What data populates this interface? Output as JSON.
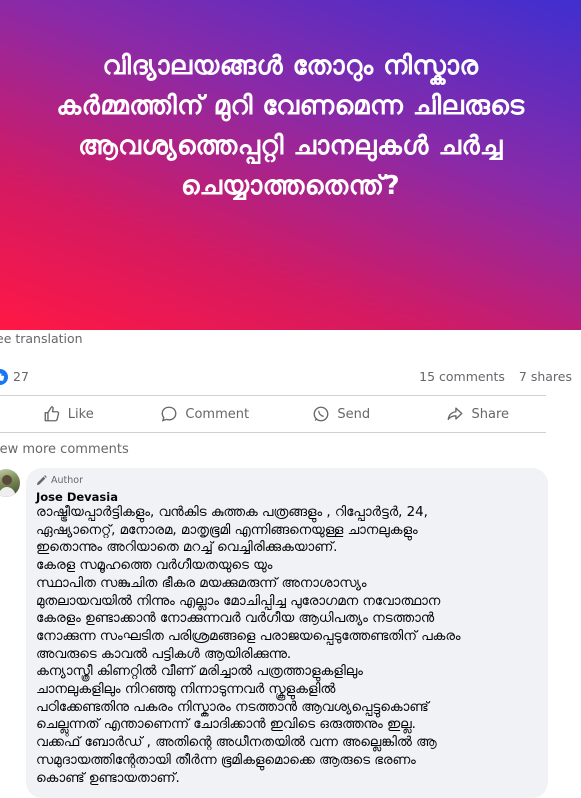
{
  "banner": {
    "title": "വിദ്യാലയങ്ങൾ തോറും നിസ്കാര കർമ്മത്തിന് മുറി വേണമെന്ന ചിലരുടെ ആവശ്യത്തെപ്പറ്റി ചാനലുകൾ ചർച്ച ചെയ്യാത്തതെന്ത്?"
  },
  "post": {
    "see_translation": "ee translation",
    "reaction_count": "27",
    "comments_count": "15 comments",
    "shares_count": "7 shares"
  },
  "actions": {
    "like": "Like",
    "comment": "Comment",
    "send": "Send",
    "share": "Share"
  },
  "comments_section": {
    "view_more": "iew more comments"
  },
  "comment": {
    "badge": "Author",
    "author": "Jose Devasia",
    "lines": [
      "രാഷ്ട്രീയപ്പാർട്ടികളും, വൻകിട കുത്തക പത്രങ്ങളും , റിപ്പോർട്ടർ, 24,",
      "ഏഷ്യാനെറ്റ്, മനോരമ, മാതൃഭൂമി എന്നിങ്ങനെയുള്ള ചാനലുകളും",
      "ഇതൊന്നും അറിയാതെ മറച്ച് വെച്ചിരിക്കുകയാണ്.",
      "കേരള സമൂഹത്തെ വർഗീയതയുടെ യും",
      "സ്ഥാപിത സങ്കുചിത ഭീകര മയക്കുമരുന്ന് അനാശാസ്യം",
      "മുതലായവയിൽ നിന്നും എല്ലാം മോചിപ്പിച്ച പുരോഗമന നവോത്ഥാന",
      "കേരളം ഉണ്ടാക്കാൻ നോക്കുന്നവർ വർഗീയ ആധിപത്യം നടത്താൻ",
      "നോക്കുന്ന സംഘടിത പരിശ്രമങ്ങളെ പരാജയപ്പെടുത്തേണ്ടതിന് പകരം",
      "അവരുടെ കാവൽ പട്ടികൾ ആയിരിക്കുന്നു.",
      "കന്യാസ്ത്രീ കിണറ്റിൽ വീണ് മരിച്ചാൽ പത്രത്താളുകളിലും",
      "ചാനലുകളിലും നിറഞ്ഞു നിന്നാടുന്നവർ സ്കൂളുകളിൽ",
      "പഠിക്കേണ്ടതിനു പകരം നിസ്കാരം നടത്താൻ ആവശ്യപ്പെട്ടുകൊണ്ട്",
      "ചെല്ലുന്നത് എന്താണെന്ന് ചോദിക്കാൻ ഇവിടെ ഒരുത്തനും ഇല്ല.",
      "വക്കഫ് ബോർഡ് , അതിന്റെ അധീനതയിൽ വന്ന അല്ലെങ്കിൽ ആ",
      "സമുദായത്തിന്റേതായി തീർന്ന ഭൂമികളുമൊക്കെ ആരുടെ ഭരണം",
      "കൊണ്ട് ഉണ്ടായതാണ്."
    ]
  },
  "colors": {
    "accent": "#1877f2",
    "secondary_text": "#65676b",
    "bubble_bg": "#f0f2f5"
  }
}
